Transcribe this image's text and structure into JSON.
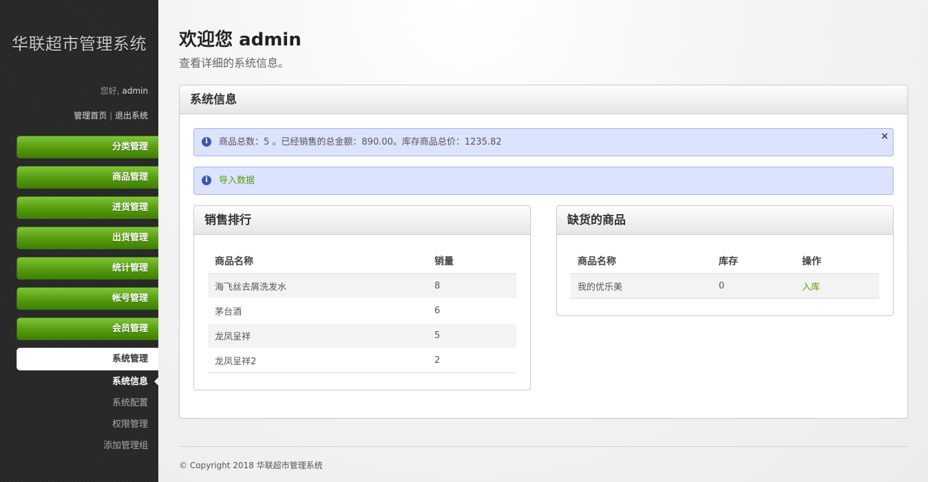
{
  "sidebar": {
    "app_title": "华联超市管理系统",
    "greeting_prefix": "您好,",
    "username": "admin",
    "links": {
      "home": "管理首页",
      "separator": "|",
      "logout": "退出系统"
    },
    "menu": [
      {
        "label": "分类管理"
      },
      {
        "label": "商品管理"
      },
      {
        "label": "进货管理"
      },
      {
        "label": "出货管理"
      },
      {
        "label": "统计管理"
      },
      {
        "label": "帐号管理"
      },
      {
        "label": "会员管理"
      },
      {
        "label": "系统管理"
      }
    ],
    "submenu": [
      {
        "label": "系统信息"
      },
      {
        "label": "系统配置"
      },
      {
        "label": "权限管理"
      },
      {
        "label": "添加管理组"
      }
    ]
  },
  "main": {
    "title": "欢迎您 admin",
    "subtitle": "查看详细的系统信息。",
    "system_box": {
      "title": "系统信息",
      "notice_stats": "商品总数：5 。已经销售的总金额：890.00。库存商品总价：1235.82",
      "notice_close": "×",
      "notice_import": "导入数据",
      "info_icon": "i"
    },
    "sales_box": {
      "title": "销售排行",
      "columns": [
        "商品名称",
        "销量"
      ],
      "rows": [
        [
          "海飞丝去屑洗发水",
          "8"
        ],
        [
          "茅台酒",
          "6"
        ],
        [
          "龙凤呈祥",
          "5"
        ],
        [
          "龙凤呈祥2",
          "2"
        ]
      ]
    },
    "stock_box": {
      "title": "缺货的商品",
      "columns": [
        "商品名称",
        "库存",
        "操作"
      ],
      "rows": [
        [
          "我的优乐美",
          "0",
          "入库"
        ]
      ]
    },
    "footer": "© Copyright 2018 华联超市管理系统"
  },
  "colors": {
    "menu_green": "#569c0e",
    "notice_bg": "#dbe3ff",
    "link_green": "#5a9c0a",
    "sidebar_bg": "#282828"
  },
  "icons": [
    "info-icon",
    "close-icon"
  ]
}
